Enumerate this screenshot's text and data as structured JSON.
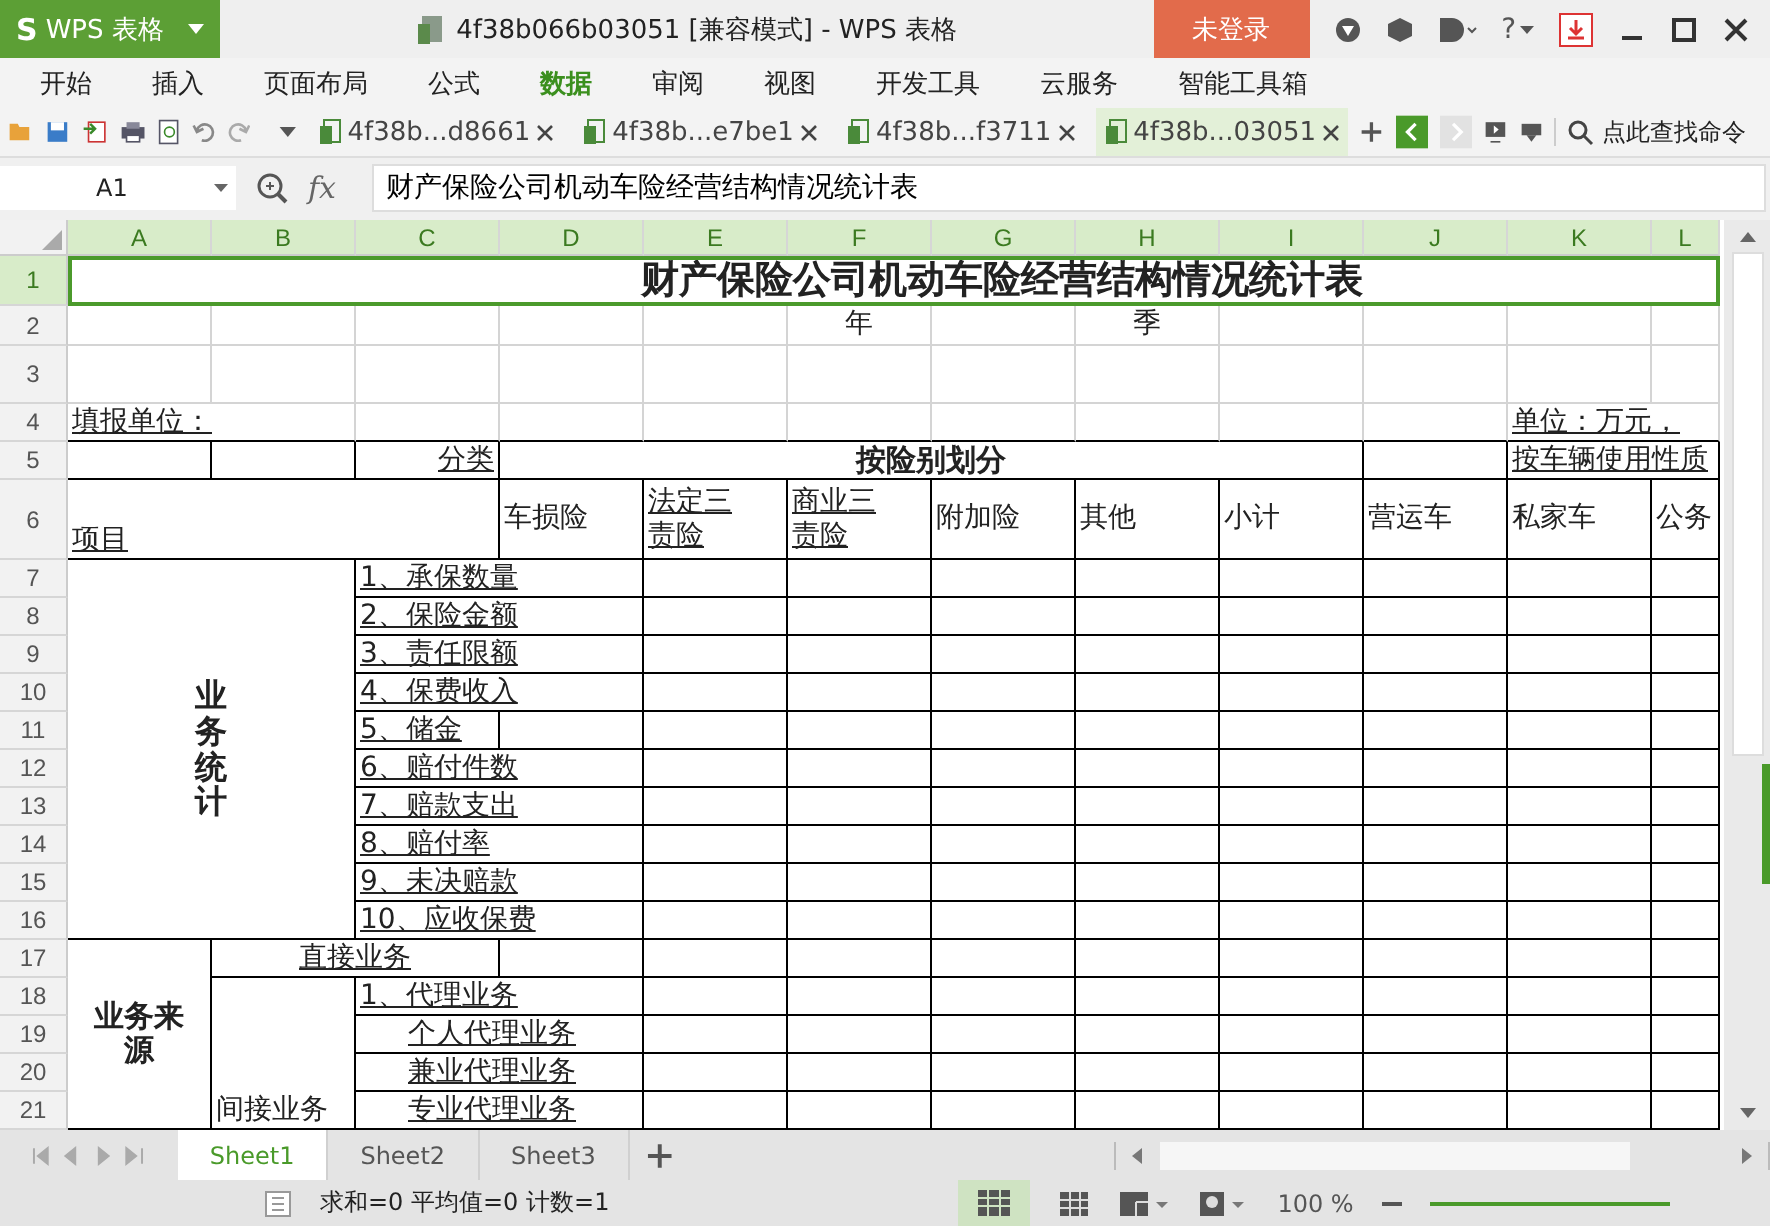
{
  "title_bar": {
    "logo": "S",
    "app_menu": "WPS 表格",
    "title": "4f38b066b03051 [兼容模式] - WPS 表格",
    "login": "未登录",
    "help": "?"
  },
  "menu_tabs": [
    {
      "label": "开始",
      "selected": false
    },
    {
      "label": "插入",
      "selected": false
    },
    {
      "label": "页面布局",
      "selected": false
    },
    {
      "label": "公式",
      "selected": false
    },
    {
      "label": "数据",
      "selected": true
    },
    {
      "label": "审阅",
      "selected": false
    },
    {
      "label": "视图",
      "selected": false
    },
    {
      "label": "开发工具",
      "selected": false
    },
    {
      "label": "云服务",
      "selected": false
    },
    {
      "label": "智能工具箱",
      "selected": false
    }
  ],
  "doc_tabs": [
    {
      "label": "4f38b...d8661",
      "selected": false
    },
    {
      "label": "4f38b...e7be1",
      "selected": false
    },
    {
      "label": "4f38b...f3711",
      "selected": false
    },
    {
      "label": "4f38b...03051",
      "selected": true
    }
  ],
  "command_search": {
    "placeholder": "点此查找命令"
  },
  "formula_bar": {
    "cell_ref": "A1",
    "fx": "fx",
    "value": "财产保险公司机动车险经营结构情况统计表"
  },
  "columns": [
    {
      "label": "A",
      "selected": true
    },
    {
      "label": "B",
      "selected": true
    },
    {
      "label": "C",
      "selected": true
    },
    {
      "label": "D",
      "selected": true
    },
    {
      "label": "E",
      "selected": true
    },
    {
      "label": "F",
      "selected": true
    },
    {
      "label": "G",
      "selected": true
    },
    {
      "label": "H",
      "selected": true
    },
    {
      "label": "I",
      "selected": true
    },
    {
      "label": "J",
      "selected": true
    },
    {
      "label": "K",
      "selected": true
    },
    {
      "label": "L",
      "selected": true
    }
  ],
  "rows": [
    {
      "label": "1",
      "selected": true
    },
    {
      "label": "2",
      "selected": false
    },
    {
      "label": "3",
      "selected": false
    },
    {
      "label": "4",
      "selected": false
    },
    {
      "label": "5",
      "selected": false
    },
    {
      "label": "6",
      "selected": false
    },
    {
      "label": "7",
      "selected": false
    },
    {
      "label": "8",
      "selected": false
    },
    {
      "label": "9",
      "selected": false
    },
    {
      "label": "10",
      "selected": false
    },
    {
      "label": "11",
      "selected": false
    },
    {
      "label": "12",
      "selected": false
    },
    {
      "label": "13",
      "selected": false
    },
    {
      "label": "14",
      "selected": false
    },
    {
      "label": "15",
      "selected": false
    },
    {
      "label": "16",
      "selected": false
    },
    {
      "label": "17",
      "selected": false
    },
    {
      "label": "18",
      "selected": false
    },
    {
      "label": "19",
      "selected": false
    },
    {
      "label": "20",
      "selected": false
    },
    {
      "label": "21",
      "selected": false
    }
  ],
  "cells": [
    {
      "text": "财产保险公司机动车险经营结构情况统计表",
      "kind": "title",
      "underline": false,
      "selected": true
    },
    {
      "text": "年",
      "kind": "text",
      "underline": false,
      "selected": false
    },
    {
      "text": "季",
      "kind": "text",
      "underline": false,
      "selected": false
    },
    {
      "text": "填报单位：",
      "kind": "text",
      "underline": true,
      "selected": false
    },
    {
      "text": "单位：万元，",
      "kind": "text",
      "underline": true,
      "selected": false
    },
    {
      "text": "分类",
      "kind": "text",
      "underline": true,
      "selected": false
    },
    {
      "text": "按险别划分",
      "kind": "bold",
      "underline": false,
      "selected": false
    },
    {
      "text": "按车辆使用性质",
      "kind": "text",
      "underline": true,
      "selected": false
    },
    {
      "text": "项目",
      "kind": "text",
      "underline": true,
      "selected": false
    },
    {
      "text": "车损险",
      "kind": "text",
      "underline": false,
      "selected": false
    },
    {
      "text": "法定三责险",
      "kind": "wrap",
      "underline": true,
      "selected": false
    },
    {
      "text": "商业三责险",
      "kind": "wrap",
      "underline": true,
      "selected": false
    },
    {
      "text": "附加险",
      "kind": "text",
      "underline": false,
      "selected": false
    },
    {
      "text": "其他",
      "kind": "text",
      "underline": false,
      "selected": false
    },
    {
      "text": "小计",
      "kind": "text",
      "underline": false,
      "selected": false
    },
    {
      "text": "营运车",
      "kind": "text",
      "underline": false,
      "selected": false
    },
    {
      "text": "私家车",
      "kind": "text",
      "underline": false,
      "selected": false
    },
    {
      "text": "公务",
      "kind": "text",
      "underline": false,
      "selected": false
    },
    {
      "text": "业务统计",
      "kind": "vertical",
      "underline": false,
      "selected": false
    },
    {
      "text": "1、承保数量",
      "kind": "text",
      "underline": true,
      "selected": false
    },
    {
      "text": "2、保险金额",
      "kind": "text",
      "underline": true,
      "selected": false
    },
    {
      "text": "3、责任限额",
      "kind": "text",
      "underline": true,
      "selected": false
    },
    {
      "text": "4、保费收入",
      "kind": "text",
      "underline": true,
      "selected": false
    },
    {
      "text": "5、储金",
      "kind": "text",
      "underline": true,
      "selected": false
    },
    {
      "text": "6、赔付件数",
      "kind": "text",
      "underline": true,
      "selected": false
    },
    {
      "text": "7、赔款支出",
      "kind": "text",
      "underline": true,
      "selected": false
    },
    {
      "text": "8、赔付率",
      "kind": "text",
      "underline": true,
      "selected": false
    },
    {
      "text": "9、未决赔款",
      "kind": "text",
      "underline": true,
      "selected": false
    },
    {
      "text": "10、应收保费",
      "kind": "text",
      "underline": true,
      "selected": false
    },
    {
      "text": "业务来源",
      "kind": "group",
      "underline": false,
      "selected": false
    },
    {
      "text": "直接业务",
      "kind": "text",
      "underline": true,
      "selected": false
    },
    {
      "text": "间接业务",
      "kind": "text",
      "underline": false,
      "selected": false
    },
    {
      "text": "1、代理业务",
      "kind": "text",
      "underline": true,
      "selected": false
    },
    {
      "text": "个人代理业务",
      "kind": "text",
      "underline": true,
      "selected": false
    },
    {
      "text": "兼业代理业务",
      "kind": "text",
      "underline": true,
      "selected": false
    },
    {
      "text": "专业代理业务",
      "kind": "text",
      "underline": true,
      "selected": false
    }
  ],
  "sheet_tabs": [
    {
      "label": "Sheet1",
      "selected": true
    },
    {
      "label": "Sheet2",
      "selected": false
    },
    {
      "label": "Sheet3",
      "selected": false
    }
  ],
  "status_bar": {
    "stats": "求和=0 平均值=0 计数=1",
    "zoom": "100 %"
  }
}
